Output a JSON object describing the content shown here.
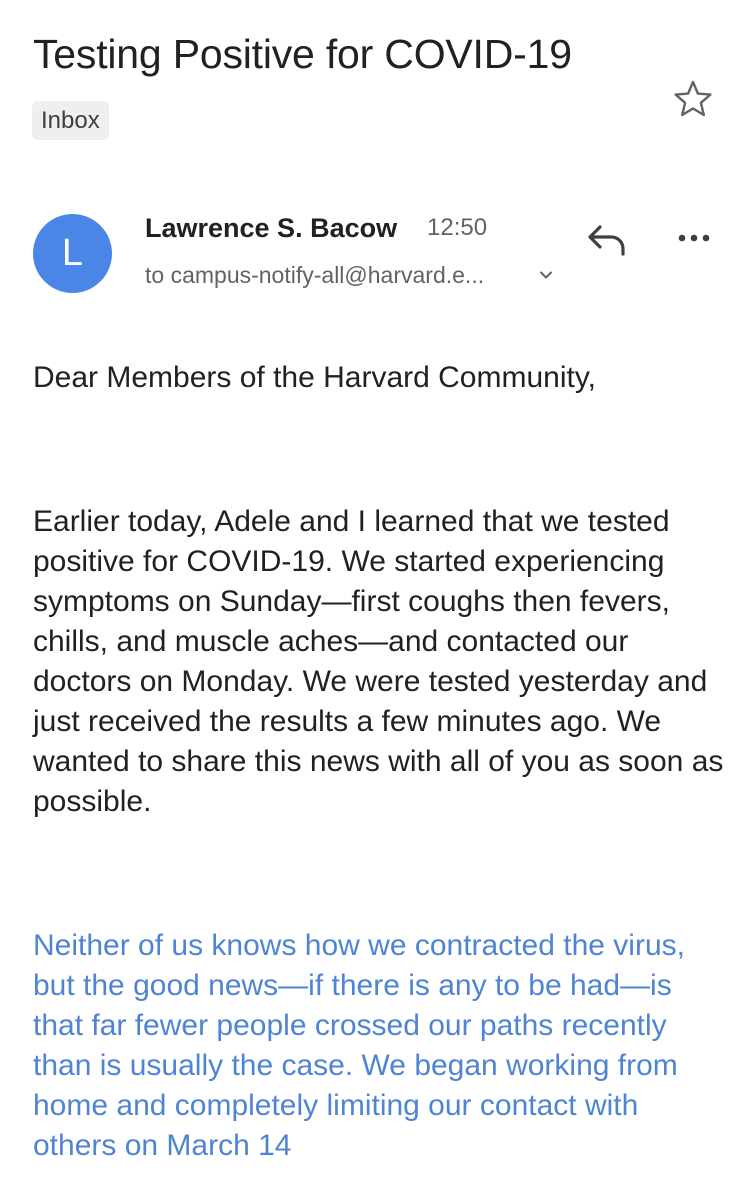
{
  "email": {
    "subject": "Testing Positive for COVID-19",
    "label": "Inbox",
    "sender": {
      "initial": "L",
      "name": "Lawrence S. Bacow",
      "time": "12:50",
      "recipient": "to campus-notify-all@harvard.e..."
    },
    "icons": {
      "star": "star-outline-icon",
      "reply": "reply-icon",
      "more": "more-horizontal-icon",
      "chevron": "chevron-down-icon"
    },
    "colors": {
      "avatar": "#4a86e8",
      "highlighted_text": "#4f84d4",
      "label_chip": "#efefef"
    },
    "body": {
      "greeting": "Dear Members of the Harvard Community,",
      "paragraph_1": "Earlier today, Adele and I learned that we tested positive for COVID-19. We started experiencing symptoms on Sunday—first coughs then fevers, chills, and muscle aches—and contacted our doctors on Monday. We were tested yesterday and just received the results a few minutes ago. We wanted to share this news with all of you as soon as possible.",
      "paragraph_2": "Neither of us knows how we contracted the virus, but the good news—if there is any to be had—is that far fewer people crossed our paths recently than is usually the case. We began working from home and completely limiting our contact with others on March 14"
    }
  }
}
